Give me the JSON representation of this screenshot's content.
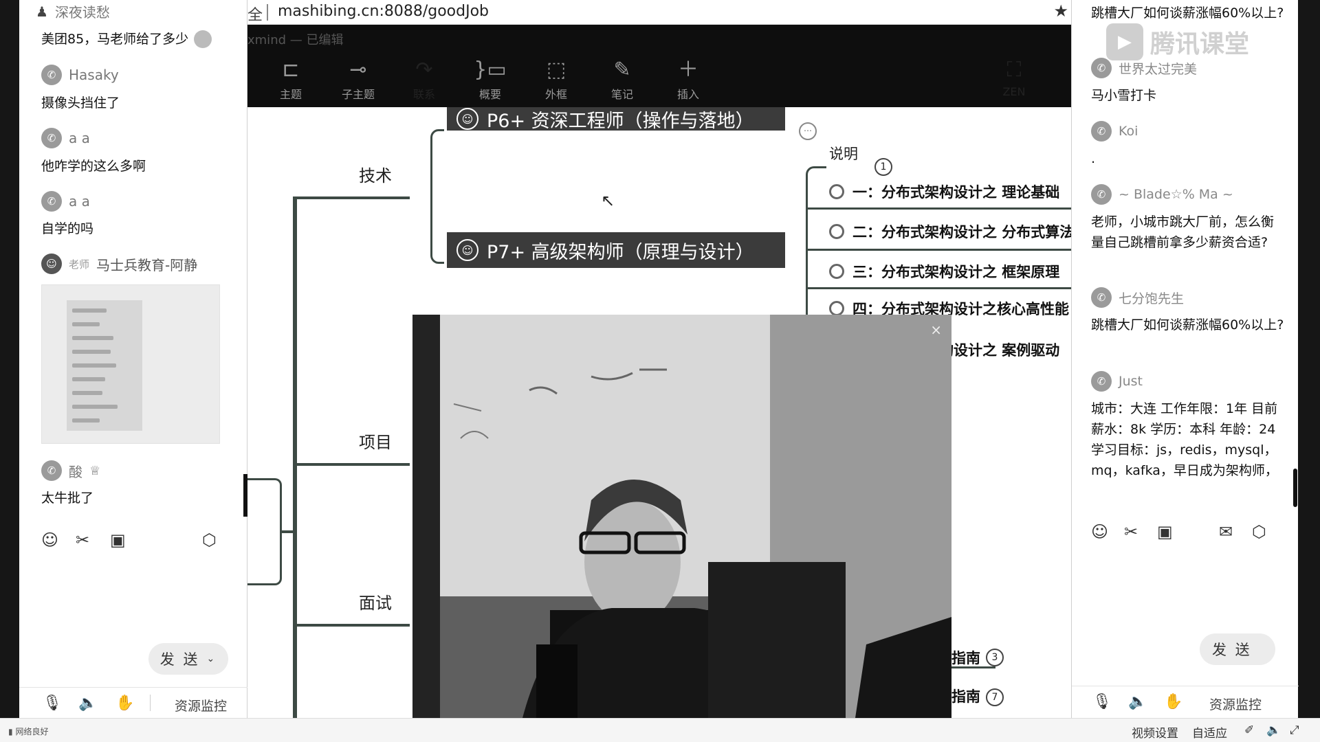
{
  "left_chat": {
    "top_user": "深夜读愁",
    "messages": [
      {
        "user": "",
        "text": "美团85，马老师给了多少"
      },
      {
        "user": "Hasaky",
        "text": "摄像头挡住了"
      },
      {
        "user": "a a",
        "text": "他咋学的这么多啊"
      },
      {
        "user": "a a",
        "text": "自学的吗"
      },
      {
        "user": "马士兵教育-阿静",
        "role": "老师",
        "text": ""
      },
      {
        "user": "酸",
        "text": "太牛批了"
      }
    ],
    "send_label": "发 送",
    "resource_monitor": "资源监控"
  },
  "browser": {
    "url": "mashibing.cn:8088/goodJob",
    "url_prefix": "全",
    "doc_title": "xmind — 已编辑"
  },
  "ribbon": {
    "items": [
      {
        "icon": "topic-icon",
        "label": "主题"
      },
      {
        "icon": "subtopic-icon",
        "label": "子主题"
      },
      {
        "icon": "relationship-icon",
        "label": "联系"
      },
      {
        "icon": "summary-icon",
        "label": "概要"
      },
      {
        "icon": "boundary-icon",
        "label": "外框"
      },
      {
        "icon": "note-icon",
        "label": "笔记"
      },
      {
        "icon": "insert-icon",
        "label": "插入"
      }
    ],
    "zen_label": "ZEN"
  },
  "mindmap": {
    "top_box": "P6+ 资深工程师（操作与落地）",
    "p7_box": "P7+ 高级架构师（原理与设计）",
    "branches": {
      "tech": "技术",
      "project": "项目",
      "interview": "面试"
    },
    "explain_label": "说明",
    "explain_badge": "1",
    "subtopics": [
      "一：分布式架构设计之 理论基础",
      "二：分布式架构设计之 分布式算法",
      "三：分布式架构设计之 框架原理",
      "四：分布式架构设计之核心高性能",
      "五：分布式架构设计之 案例驱动"
    ],
    "guide_1": "指南",
    "guide_2": "指南",
    "badge_3": "3",
    "badge_7": "7"
  },
  "video": {
    "close": "×"
  },
  "right_chat": {
    "watermark": "腾讯课堂",
    "messages": [
      {
        "user": "",
        "text": "跳槽大厂如何谈薪涨幅60%以上?"
      },
      {
        "user": "世界太过完美",
        "text": "马小雪打卡"
      },
      {
        "user": "Koi",
        "text": "."
      },
      {
        "user": "~ Blade☆% Ma ~",
        "text": "老师，小城市跳大厂前，怎么衡量自己跳槽前拿多少薪资合适?"
      },
      {
        "user": "七分饱先生",
        "text": "跳槽大厂如何谈薪涨幅60%以上?"
      },
      {
        "user": "Just",
        "text": "城市：大连 工作年限：1年 目前薪水：8k 学历：本科 年龄：24 学习目标：js，redis，mysql，mq，kafka，早日成为架构师，"
      }
    ],
    "send_label": "发 送",
    "resource_monitor": "资源监控"
  },
  "statusbar": {
    "network": "网络良好",
    "video_settings": "视频设置",
    "auto_fit": "自适应"
  }
}
